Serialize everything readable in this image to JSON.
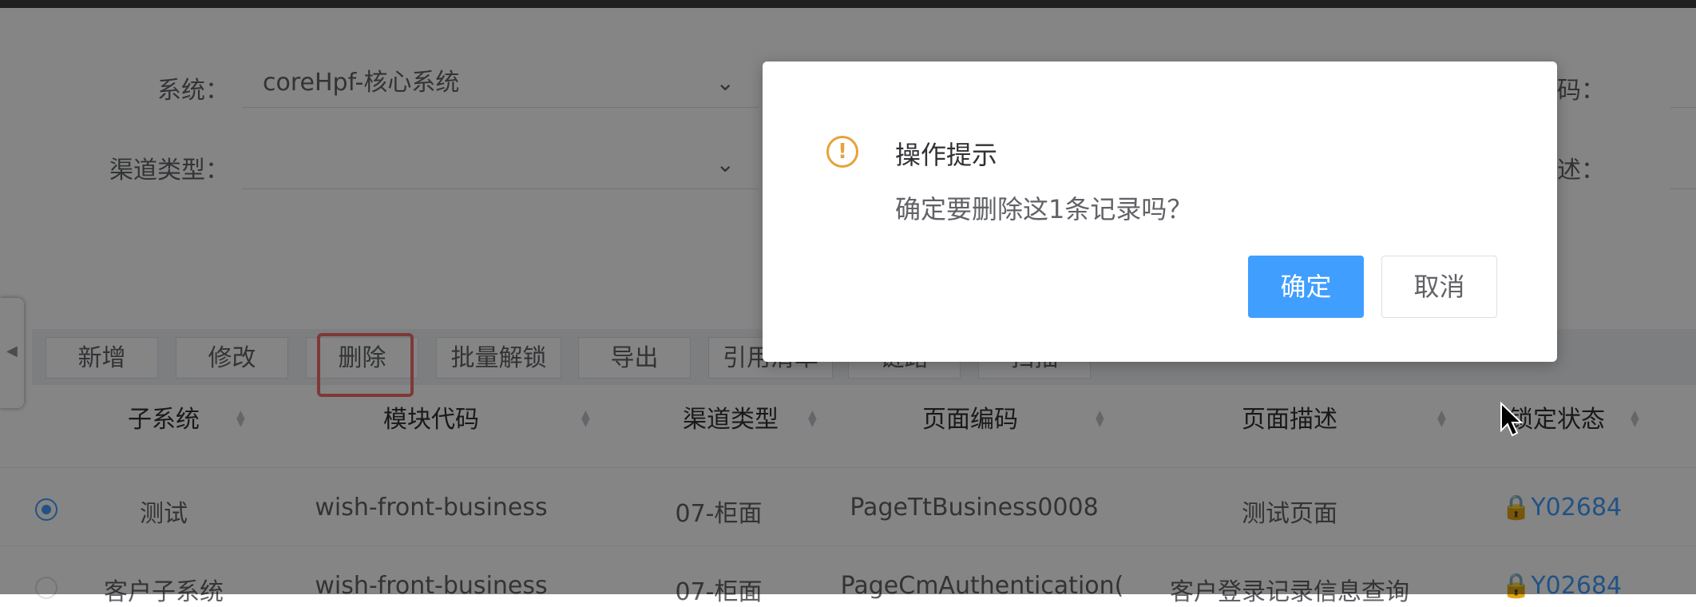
{
  "filters": {
    "system_label": "系统：",
    "system_value": "coreHpf-核心系统",
    "channel_label": "渠道类型：",
    "channel_value": "",
    "module_code_label": "块代码：",
    "page_desc_label": "面描述："
  },
  "toolbar": {
    "add": "新增",
    "edit": "修改",
    "delete": "删除",
    "batch_unlock": "批量解锁",
    "export": "导出",
    "reference_list": "引用清单",
    "link": "链路",
    "scan": "扫描"
  },
  "table": {
    "columns": [
      "子系统",
      "模块代码",
      "渠道类型",
      "页面编码",
      "页面描述",
      "锁定状态"
    ],
    "rows": [
      {
        "selected": true,
        "subsystem": "测试",
        "module": "wish-front-business",
        "channel": "07-柜面",
        "page_code": "PageTtBusiness0008",
        "page_desc": "测试页面",
        "lock": "Y02684"
      },
      {
        "selected": false,
        "subsystem": "客户子系统",
        "module": "wish-front-business",
        "channel": "07-柜面",
        "page_code": "PageCmAuthentication(",
        "page_desc": "客户登录记录信息查询",
        "lock": "Y02684"
      }
    ]
  },
  "dialog": {
    "title": "操作提示",
    "message": "确定要删除这1条记录吗？",
    "confirm": "确定",
    "cancel": "取消"
  },
  "colors": {
    "primary": "#409eff",
    "warning": "#e6a23c",
    "highlight": "#f56c6c"
  }
}
